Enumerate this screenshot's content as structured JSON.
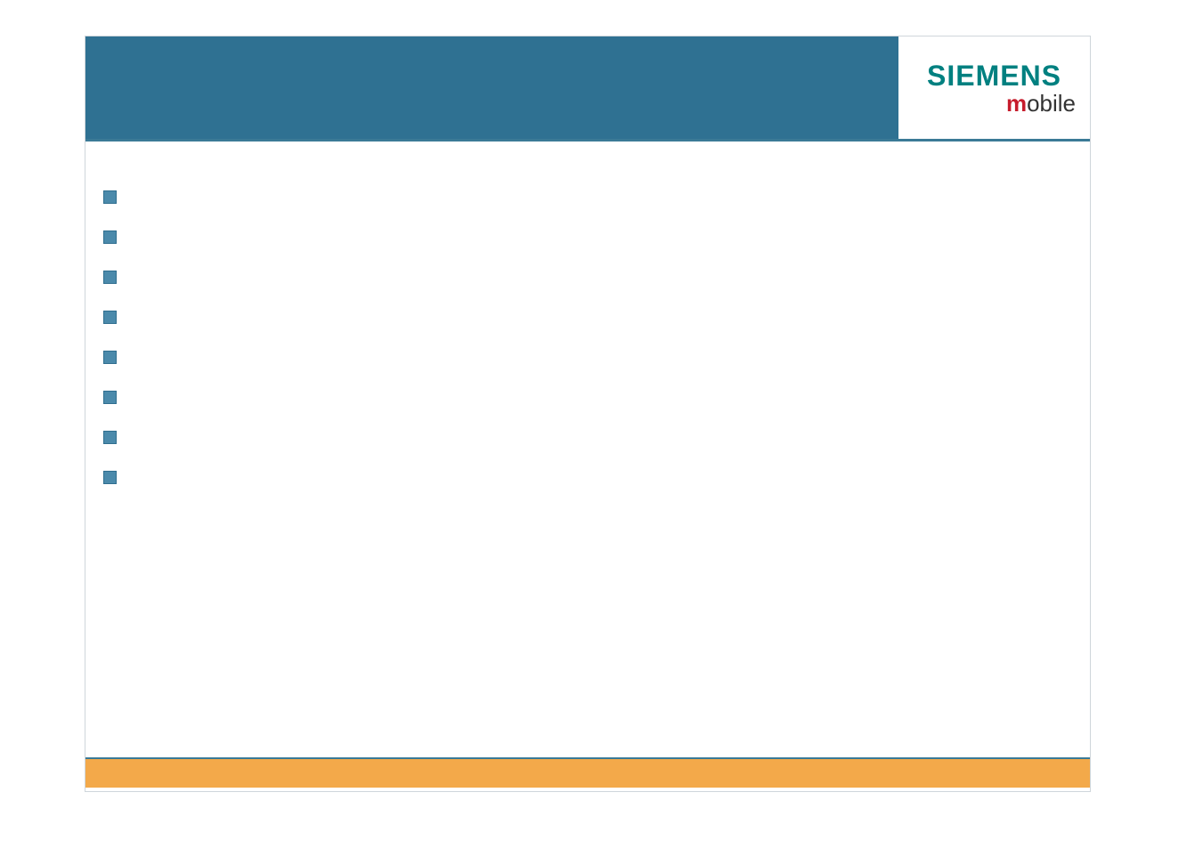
{
  "logo": {
    "brand": "SIEMENS",
    "sub_prefix": "m",
    "sub_rest": "obile"
  },
  "bullets": [
    {
      "text": ""
    },
    {
      "text": ""
    },
    {
      "text": ""
    },
    {
      "text": ""
    },
    {
      "text": ""
    },
    {
      "text": ""
    },
    {
      "text": ""
    },
    {
      "text": ""
    }
  ],
  "colors": {
    "header": "#2f7192",
    "accent": "#f3a94a",
    "brand_teal": "#008080",
    "brand_red": "#c61c2c",
    "bullet_fill": "#4b8aab"
  }
}
